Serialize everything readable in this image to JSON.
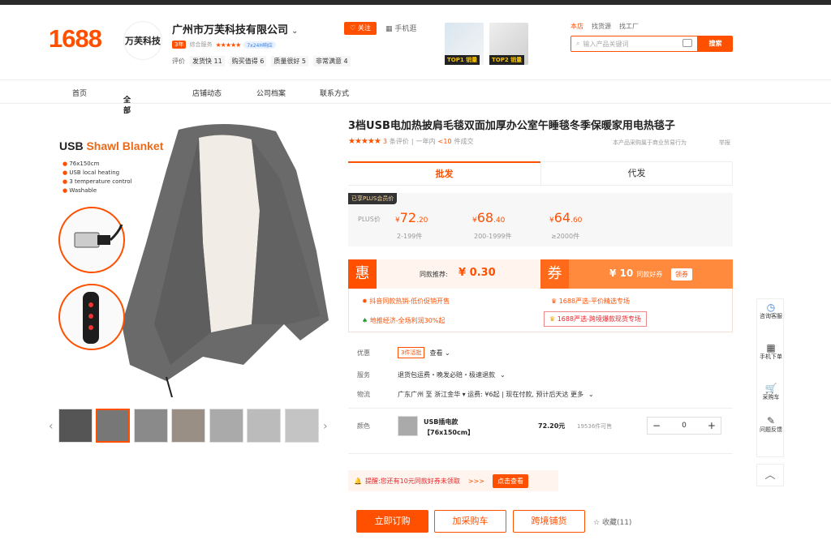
{
  "header": {
    "logo": "1688",
    "shop_logo_text": "万芙科技",
    "shop_name": "广州市万芙科技有限公司",
    "follow_label": "关注",
    "mobile_label": "手机逛",
    "years_badge": "3年",
    "service_label": "综合服务",
    "support_badge": "7x24H响应",
    "eval_label": "评价",
    "eval_tags": [
      "发货快 11",
      "质量很好 5",
      "非常满意 4"
    ],
    "eval_extra": "购买值得 6",
    "top1_label": "TOP1 销量",
    "top2_label": "TOP2 销量",
    "search_tabs": [
      "本店",
      "找货源",
      "找工厂"
    ],
    "search_placeholder": "输入产品关键词",
    "search_button": "搜索"
  },
  "nav": {
    "items": [
      "首页",
      "全部商品",
      "店铺动态",
      "公司档案",
      "联系方式"
    ]
  },
  "gallery": {
    "image_title_part1": "USB",
    "image_title_part2": "Shawl Blanket",
    "bullets": [
      "76x150cm",
      "USB local heating",
      "3 temperature control",
      "Washable"
    ]
  },
  "product": {
    "title": "3档USB电加热披肩毛毯双面加厚办公室午睡毯冬季保暖家用电热毯子",
    "review_count": "3",
    "review_label": "条评价",
    "sales_prefix": "一年内",
    "sales_value": "<10",
    "sales_suffix": "件成交",
    "industry_note": "本产品采购属于商业贸易行为",
    "report": "举报",
    "tab_wholesale": "批发",
    "tab_dropship": "代发",
    "plus_tag": "已享PLUS会员价",
    "plus_label": "PLUS价",
    "prices": [
      {
        "yen": "¥",
        "int": "72",
        "dec": ".20",
        "range": "2-199件"
      },
      {
        "yen": "¥",
        "int": "68",
        "dec": ".40",
        "range": "200-1999件"
      },
      {
        "yen": "¥",
        "int": "64",
        "dec": ".60",
        "range": "≥2000件"
      }
    ],
    "hui": "惠",
    "same_rec_label": "同款推荐:",
    "same_rec_value": "¥ 0.30",
    "quan": "券",
    "coupon_value": "¥ 10",
    "coupon_note": "同款好券",
    "coupon_btn": "领券",
    "promos": [
      "抖音同款热销-低价促销开售",
      "1688严选-平价精选专场",
      "地推经济-全场利润30%起",
      "1688严选-跨境爆款现货专场"
    ],
    "attr_labels": [
      "优惠",
      "服务",
      "物流",
      "颜色"
    ],
    "discount_tag": "3件活批",
    "discount_more": "查看",
    "service_text": "退货包运费・晚发必赔・极速退款",
    "logistics_text": "广东广州 至 浙江金华 ▾ 运费: ¥6起 | 现在付款, 预计后天达 更多",
    "sku_name": "USB插电款【76x150cm】",
    "sku_price": "72.20元",
    "sku_stock": "19536件可售",
    "quantity": "0",
    "reminder": "提醒:您还有10元同款好券未领取",
    "reminder_arrows": ">>>",
    "reminder_btn": "点击查看",
    "buy_label": "立即订购",
    "cart_label": "加采购车",
    "cross_label": "跨境铺货",
    "fav_label": "收藏(11)"
  },
  "sidebar": {
    "items": [
      "咨询客服",
      "手机下单",
      "采购车",
      "问题反馈"
    ]
  },
  "colors": {
    "accent": "#ff5000"
  }
}
